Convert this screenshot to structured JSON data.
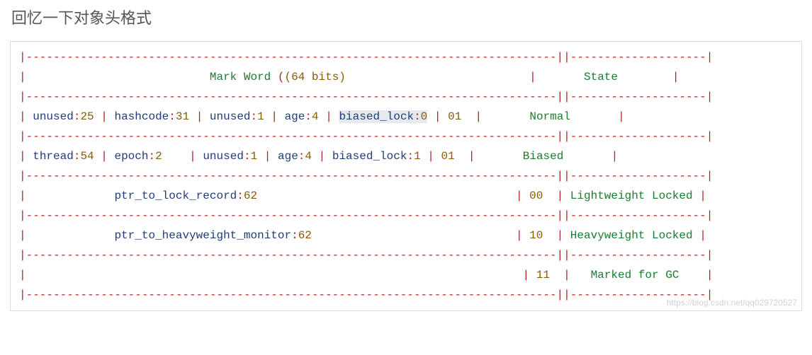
{
  "title": "回忆一下对象头格式",
  "hr_main": "|------------------------------------------------------------------------------|",
  "hr_state": "|--------------------|",
  "header": {
    "mark": "Mark Word ",
    "bits": "(64 bits)",
    "pad_l": "                           ",
    "pad_r": "                           ",
    "state": "State",
    "state_pad_l": "       ",
    "state_pad_r": "        "
  },
  "row_normal": {
    "f1": "unused",
    "v1": "25",
    "f2": "hashcode",
    "v2": "31",
    "f3": "unused",
    "v3": "1",
    "f4": "age",
    "v4": "4",
    "f5": "biased_lock",
    "v5": "0",
    "tag": "01",
    "state": "Normal",
    "state_pad_l": "       ",
    "state_pad_r": "       "
  },
  "row_biased": {
    "f1": "thread",
    "v1": "54",
    "f2": "epoch",
    "v2": "2",
    "f3": "unused",
    "v3": "1",
    "f4": "age",
    "v4": "4",
    "f5": "biased_lock",
    "v5": "1",
    "tag": "01",
    "state": "Biased",
    "state_pad_l": "       ",
    "state_pad_r": "       "
  },
  "row_light": {
    "field": "ptr_to_lock_record",
    "val": "62",
    "pad_l": "             ",
    "pad_r": "                                      ",
    "tag": "00",
    "state": "Lightweight Locked",
    "state_pad_l": " ",
    "state_pad_r": " "
  },
  "row_heavy": {
    "field": "ptr_to_heavyweight_monitor",
    "val": "62",
    "pad_l": "             ",
    "pad_r": "                              ",
    "tag": "10",
    "state": "Heavyweight Locked",
    "state_pad_l": " ",
    "state_pad_r": " "
  },
  "row_gc": {
    "pad": "                                                                         ",
    "tag": "11",
    "state": "Marked for GC",
    "state_pad_l": "   ",
    "state_pad_r": "    "
  },
  "watermark": "https://blog.csdn.net/qq029720527"
}
